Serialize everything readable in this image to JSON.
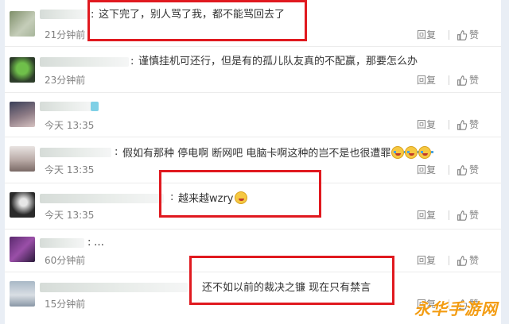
{
  "comments": [
    {
      "text": "这下完了，别人骂了我，都不能骂回去了",
      "time": "21分钟前",
      "reply": "回复",
      "like": "赞"
    },
    {
      "text": "谨慎挂机可还行，但是有的孤儿队友真的不配赢，那要怎么办",
      "time": "23分钟前",
      "reply": "回复",
      "like": "赞"
    },
    {
      "text": "",
      "time": "今天 13:35",
      "reply": "回复",
      "like": "赞"
    },
    {
      "text": "假如有那种 停电啊 断网吧 电脑卡啊这种的岂不是也很遭罪",
      "time": "今天 13:35",
      "reply": "回复",
      "like": "赞"
    },
    {
      "text": "越来越wzry",
      "time": "今天 13:35",
      "reply": "回复",
      "like": "赞"
    },
    {
      "text": "…",
      "time": "60分钟前",
      "reply": "回复",
      "like": "赞"
    },
    {
      "text": "还不如以前的裁决之镰  现在只有禁言",
      "time": "15分钟前",
      "reply": "回复",
      "like": "赞"
    }
  ],
  "watermark": "永华手游网"
}
